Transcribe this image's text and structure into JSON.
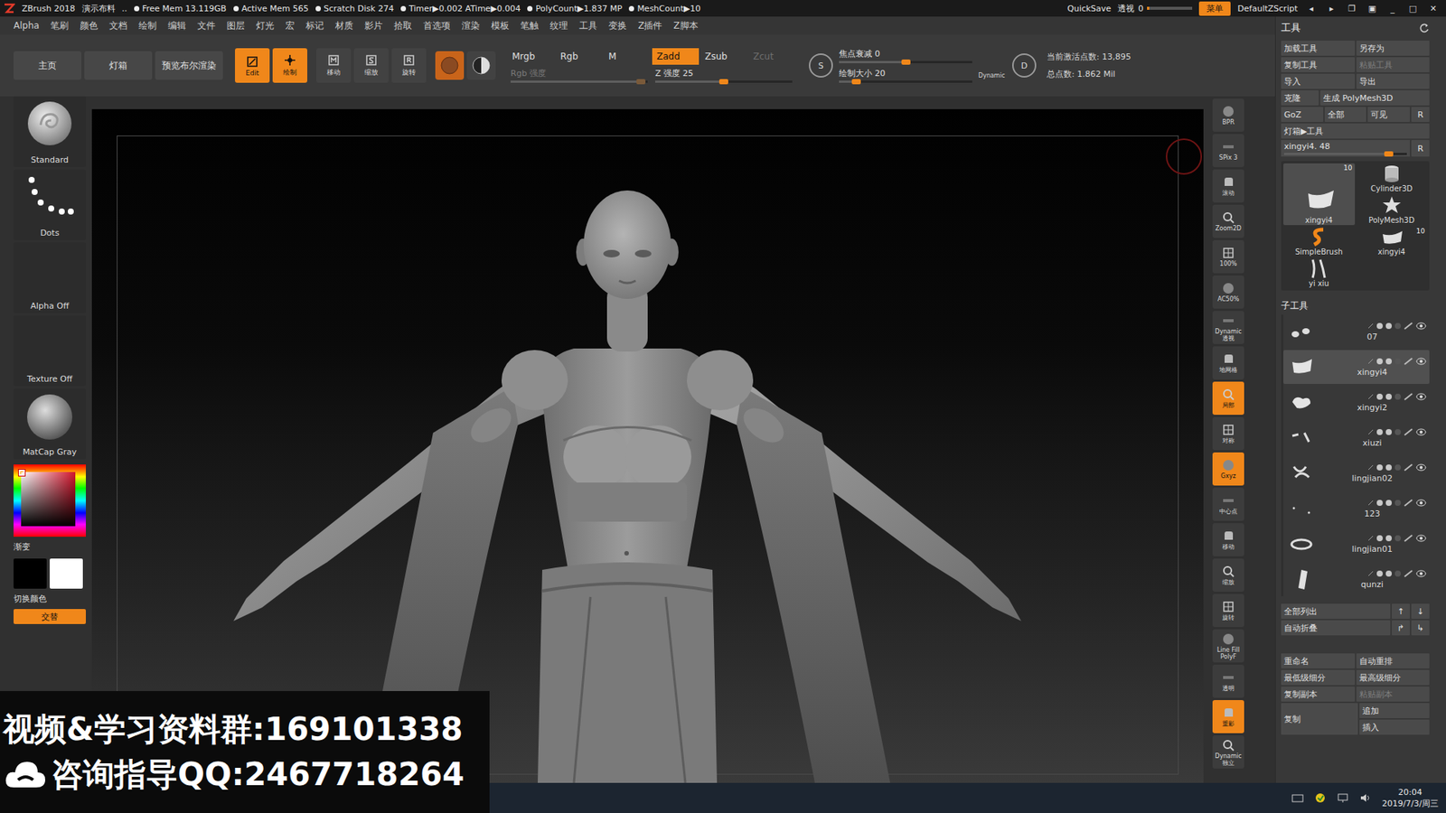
{
  "title_bar": {
    "app": "ZBrush 2018",
    "document": "演示布料",
    "ellipsis": "..",
    "stats": [
      "Free Mem 13.119GB",
      "Active Mem 565",
      "Scratch Disk 274",
      "Timer▶0.002 ATime▶0.004",
      "PolyCount▶1.837 MP",
      "MeshCount▶10"
    ],
    "quicksave": "QuickSave",
    "perspective": {
      "label": "透视",
      "value": "0",
      "level": 0.05
    },
    "menu_button": {
      "label": "菜单",
      "selected": true
    },
    "script": "DefaultZScript",
    "controls": [
      "◂",
      "▸",
      "❐",
      "▣",
      "_",
      "□",
      "✕"
    ]
  },
  "menu_bar": [
    "Alpha",
    "笔刷",
    "颜色",
    "文档",
    "绘制",
    "编辑",
    "文件",
    "图层",
    "灯光",
    "宏",
    "标记",
    "材质",
    "影片",
    "拾取",
    "首选项",
    "渲染",
    "模板",
    "笔触",
    "纹理",
    "工具",
    "变换",
    "Z插件",
    "Z脚本"
  ],
  "top_shelf": {
    "nav": [
      "主页",
      "灯箱",
      "预览布尔渲染"
    ],
    "modes": [
      {
        "label": "Edit",
        "selected": true
      },
      {
        "label": "绘制",
        "selected": true
      },
      {
        "label": "移动",
        "selected": false
      },
      {
        "label": "缩放",
        "selected": false
      },
      {
        "label": "旋转",
        "selected": false
      }
    ],
    "material_buttons": [
      {
        "selected": true
      },
      {
        "selected": false
      }
    ],
    "channels": [
      {
        "label": "Mrgb",
        "selected": false,
        "disabled": false
      },
      {
        "label": "Rgb",
        "selected": false,
        "disabled": false
      },
      {
        "label": "M",
        "selected": false,
        "disabled": false
      }
    ],
    "rgb_intensity": {
      "label": "Rgb 强度",
      "level": 0.95,
      "disabled": true
    },
    "sculpt_modes": [
      {
        "label": "Zadd",
        "selected": true,
        "disabled": false
      },
      {
        "label": "Zsub",
        "selected": false,
        "disabled": false
      },
      {
        "label": "Zcut",
        "selected": false,
        "disabled": true
      }
    ],
    "z_intensity": {
      "label": "Z 强度 25",
      "level": 0.5,
      "disabled": false
    },
    "focal_icon": "S",
    "focal_shift": {
      "label": "焦点衰减 0",
      "level": 0.5,
      "disabled": false
    },
    "draw_size": {
      "label": "绘制大小 20",
      "level": 0.13,
      "disabled": false
    },
    "dynamic": "Dynamic",
    "draw_icon": "D",
    "active_points": "当前激活点数: 13,895",
    "total_points": "总点数: 1.862 Mil"
  },
  "left_shelf": {
    "brush": "Standard",
    "stroke": "Dots",
    "alpha": "Alpha Off",
    "texture": "Texture Off",
    "material": "MatCap Gray",
    "hue_color": "#d4142c",
    "gradient": "渐变",
    "main_color": "#000000",
    "secondary_color": "#ffffff",
    "switch_color": "切换颜色",
    "alternate": {
      "label": "交替",
      "selected": true
    }
  },
  "canvas_tools": [
    {
      "label": "BPR",
      "selected": false
    },
    {
      "label": "SPix 3",
      "selected": false
    },
    {
      "label": "滚动",
      "selected": false
    },
    {
      "label": "Zoom2D",
      "selected": false
    },
    {
      "label": "100%",
      "selected": false
    },
    {
      "label": "AC50%",
      "selected": false
    },
    {
      "label": "Dynamic 透视",
      "selected": false
    },
    {
      "label": "地网格",
      "selected": false
    },
    {
      "label": "局部",
      "selected": true
    },
    {
      "label": "对称",
      "selected": false
    },
    {
      "label": "Gxyz",
      "selected": true
    },
    {
      "label": "中心点",
      "selected": false
    },
    {
      "label": "移动",
      "selected": false
    },
    {
      "label": "缩放",
      "selected": false
    },
    {
      "label": "旋转",
      "selected": false
    },
    {
      "label": "Line Fill PolyF",
      "selected": false
    },
    {
      "label": "透明",
      "selected": false
    },
    {
      "label": "重影",
      "selected": true
    },
    {
      "label": "Dynamic 独立",
      "selected": false
    }
  ],
  "tool_palette": {
    "title": "工具",
    "button_rows": [
      [
        {
          "label": "加载工具",
          "disabled": false
        },
        {
          "label": "另存为",
          "disabled": false
        }
      ],
      [
        {
          "label": "复制工具",
          "disabled": false
        },
        {
          "label": "粘贴工具",
          "disabled": true
        }
      ],
      [
        {
          "label": "导入",
          "disabled": false
        },
        {
          "label": "导出",
          "disabled": false
        }
      ],
      [
        {
          "label": "克隆",
          "disabled": false
        },
        {
          "label": "生成 PolyMesh3D",
          "disabled": false
        }
      ],
      [
        {
          "label": "GoZ",
          "disabled": false
        },
        {
          "label": "全部",
          "disabled": false
        },
        {
          "label": "可见",
          "disabled": false
        },
        {
          "label": "R",
          "disabled": false
        }
      ],
      [
        {
          "label": "灯箱▶工具",
          "disabled": false
        }
      ]
    ],
    "tool_slider": {
      "label": "xingyi4. 48",
      "level": 0.85,
      "disabled": false
    },
    "tool_slider_reset": "R",
    "tools": [
      {
        "label": "xingyi4",
        "badge": "10",
        "selected": true
      },
      {
        "label": "Cylinder3D",
        "selected": false
      },
      {
        "label": "PolyMesh3D",
        "selected": false
      },
      {
        "label": "SimpleBrush",
        "selected": false
      },
      {
        "label": "xingyi4",
        "badge": "10",
        "selected": false
      },
      {
        "label": "yi xiu",
        "selected": false
      }
    ],
    "subtool_title": "子工具",
    "subtools": [
      {
        "name": "07",
        "selected": false,
        "visible": true
      },
      {
        "name": "xingyi4",
        "selected": true,
        "visible": true
      },
      {
        "name": "xingyi2",
        "selected": false,
        "visible": true
      },
      {
        "name": "xiuzi",
        "selected": false,
        "visible": true
      },
      {
        "name": "lingjian02",
        "selected": false,
        "visible": true
      },
      {
        "name": "123",
        "selected": false,
        "visible": true
      },
      {
        "name": "lingjian01",
        "selected": false,
        "visible": true
      },
      {
        "name": "qunzi",
        "selected": false,
        "visible": true
      }
    ],
    "list_rows": [
      [
        {
          "label": "全部列出",
          "disabled": false
        },
        {
          "label": "↑",
          "disabled": false
        },
        {
          "label": "↓",
          "disabled": false
        }
      ],
      [
        {
          "label": "自动折叠",
          "disabled": false
        },
        {
          "label": "↱",
          "disabled": false
        },
        {
          "label": "↳",
          "disabled": false
        }
      ]
    ],
    "action_rows": [
      [
        {
          "label": "重命名",
          "disabled": false
        },
        {
          "label": "自动重排",
          "disabled": false
        }
      ],
      [
        {
          "label": "最低级细分",
          "disabled": false
        },
        {
          "label": "最高级细分",
          "disabled": false
        }
      ],
      [
        {
          "label": "复制副本",
          "disabled": false
        },
        {
          "label": "粘贴副本",
          "disabled": true
        }
      ]
    ],
    "copy": "复制",
    "append": "追加",
    "insert": "插入"
  },
  "watermark": {
    "line1": "视频&学习资料群:169101338",
    "line2": "咨询指导QQ:2467718264"
  },
  "taskbar": {
    "time": "20:04",
    "date": "2019/7/3/周三"
  }
}
